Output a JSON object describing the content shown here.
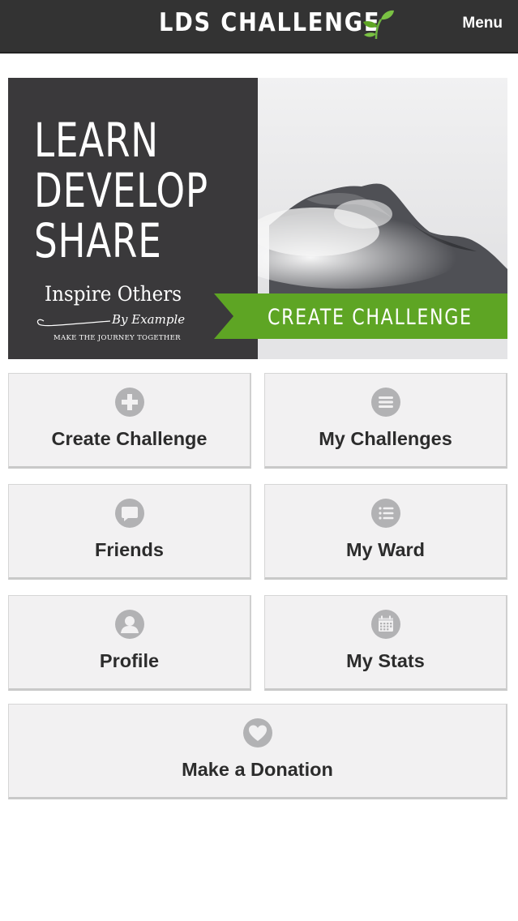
{
  "header": {
    "title": "LDS CHALLENGE",
    "menu_label": "Menu",
    "logo_icon": "sprout-icon"
  },
  "banner": {
    "lines": [
      "LEARN",
      "DEVELOP",
      "SHARE"
    ],
    "tagline": "Inspire Others",
    "by_line": "By Example",
    "subline": "MAKE THE JOURNEY TOGETHER",
    "cta_label": "CREATE CHALLENGE",
    "image": "misty-mountain-peak"
  },
  "tiles": [
    {
      "label": "Create Challenge",
      "icon": "plus-circle-icon"
    },
    {
      "label": "My Challenges",
      "icon": "menu-lines-icon"
    },
    {
      "label": "Friends",
      "icon": "chat-bubble-icon"
    },
    {
      "label": "My Ward",
      "icon": "list-icon"
    },
    {
      "label": "Profile",
      "icon": "user-icon"
    },
    {
      "label": "My Stats",
      "icon": "calendar-icon"
    },
    {
      "label": "Make a Donation",
      "icon": "heart-icon"
    }
  ],
  "colors": {
    "header_bg": "#333333",
    "banner_dark": "#3a393b",
    "accent_green": "#5ea524",
    "tile_bg": "#f2f1f2",
    "icon_gray": "#b2b2b4",
    "label_text": "#2c2c2c"
  }
}
